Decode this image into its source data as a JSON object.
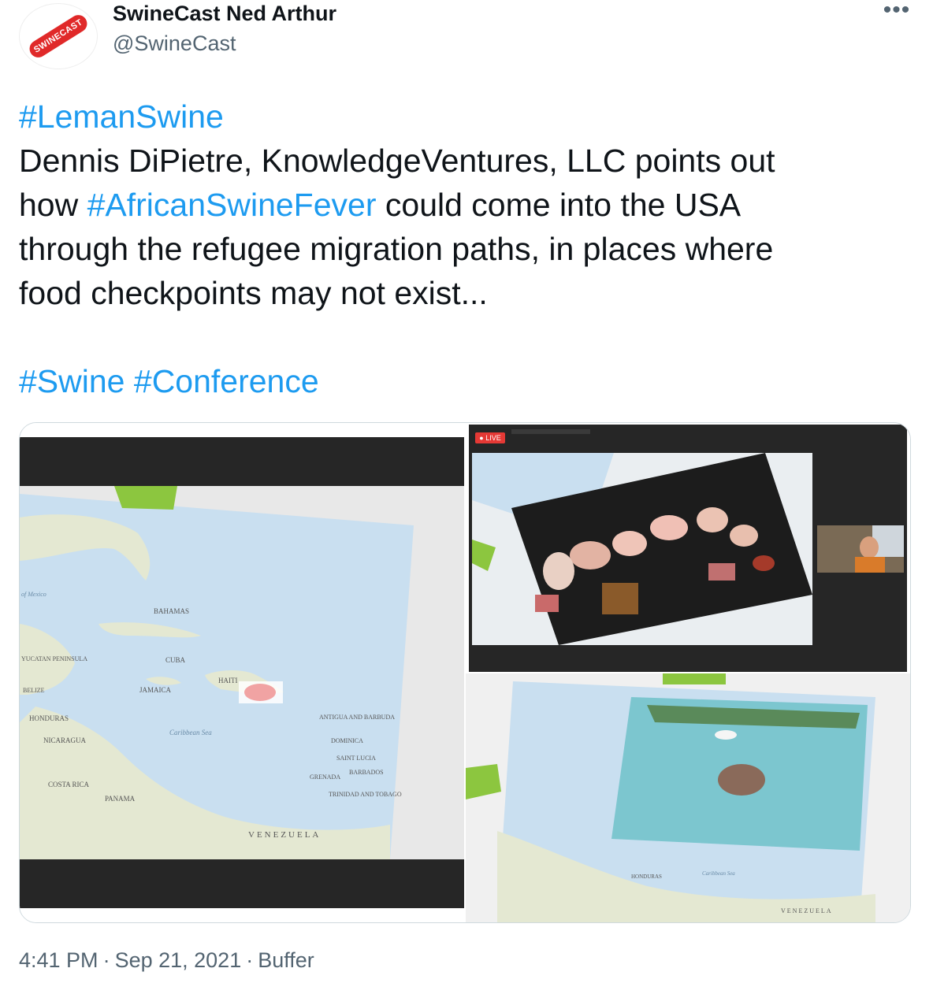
{
  "author": {
    "display_name": "SwineCast Ned Arthur",
    "handle": "@SwineCast",
    "avatar_text": "SWINECAST"
  },
  "more_icon": "•••",
  "tweet": {
    "hashtag_top": "#LemanSwine",
    "line1": "Dennis DiPietre, KnowledgeVentures, LLC points out",
    "line2_before": "how ",
    "line2_hashtag": "#AfricanSwineFever",
    "line2_after": " could come into the USA",
    "line3": "through the refugee migration paths, in places where",
    "line4": "food checkpoints may not exist...",
    "hashtag_swine": "#Swine",
    "hashtag_conference": "#Conference"
  },
  "media": {
    "live_badge": "● LIVE",
    "map_labels": {
      "bahamas": "BAHAMAS",
      "cuba": "CUBA",
      "jamaica": "JAMAICA",
      "haiti": "HAITI",
      "honduras": "HONDURAS",
      "nicaragua": "NICARAGUA",
      "costa_rica": "COSTA RICA",
      "panama": "PANAMA",
      "venezuela": "VENEZUELA",
      "caribbean_sea": "Caribbean Sea",
      "antigua": "ANTIGUA AND BARBUDA",
      "dominica": "DOMINICA",
      "saint_lucia": "SAINT LUCIA",
      "grenada": "GRENADA",
      "barbados": "BARBADOS",
      "trinidad": "TRINIDAD AND TOBAGO",
      "yucatan": "YUCATAN PENINSULA",
      "belize": "BELIZE",
      "gulf_mexico": "of Mexico"
    }
  },
  "footer": {
    "time": "4:41 PM",
    "date": "Sep 21, 2021",
    "source": "Buffer",
    "separator": "·"
  },
  "colors": {
    "accent": "#1d9bf0",
    "text": "#0f1419",
    "secondary": "#536471",
    "live": "#e53935"
  }
}
